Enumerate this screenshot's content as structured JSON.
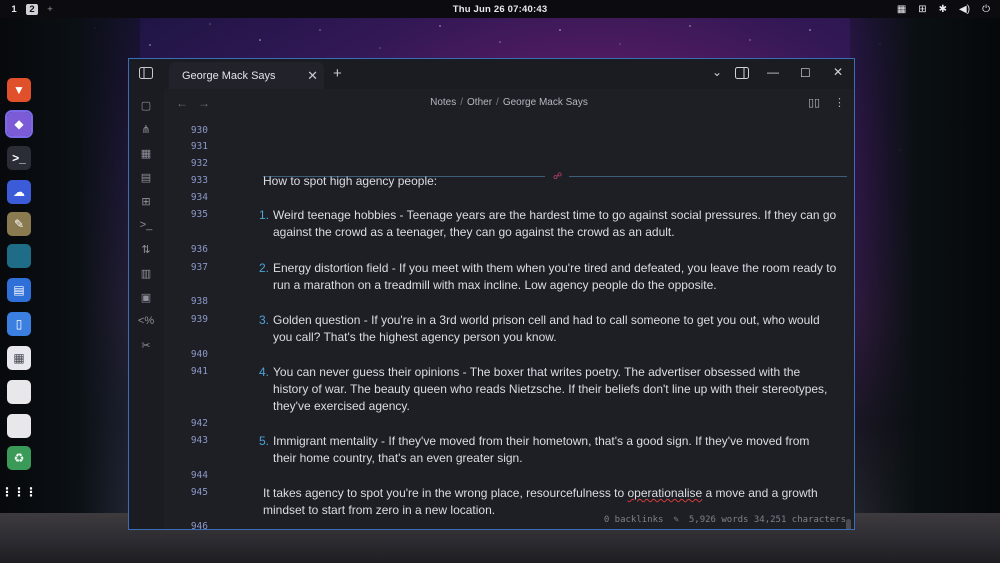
{
  "topbar": {
    "workspaces": [
      "1",
      "2"
    ],
    "active_workspace": "2",
    "add_workspace": "+",
    "clock": "Thu Jun 26  07:40:43"
  },
  "dock": {
    "apps": [
      {
        "name": "brave-icon",
        "color": "#e0502a",
        "glyph": "▼"
      },
      {
        "name": "obsidian-icon",
        "color": "#7b5cd6",
        "glyph": "◆"
      },
      {
        "name": "terminal-icon",
        "color": "#2a2d36",
        "glyph": ">_"
      },
      {
        "name": "weather-app-icon",
        "color": "#3b5bd9",
        "glyph": "☁"
      },
      {
        "name": "gimp-icon",
        "color": "#8a7a50",
        "glyph": "✎"
      },
      {
        "name": "panel-app-icon",
        "color": "#1f6c86",
        "glyph": ""
      },
      {
        "name": "document-editor-icon",
        "color": "#2f6fd8",
        "glyph": "▤"
      },
      {
        "name": "text-editor-icon",
        "color": "#3b7fe0",
        "glyph": "▯"
      },
      {
        "name": "software-store-icon",
        "color": "#e8e8ee",
        "glyph": "▦"
      },
      {
        "name": "blank-app-icon-1",
        "color": "#e8e8ea",
        "glyph": ""
      },
      {
        "name": "blank-app-icon-2",
        "color": "#e8e8ea",
        "glyph": ""
      },
      {
        "name": "trash-icon",
        "color": "#3a9a58",
        "glyph": "♻"
      },
      {
        "name": "app-grid-icon",
        "color": "transparent",
        "glyph": "⋮⋮⋮"
      }
    ]
  },
  "window": {
    "tab_title": "George Mack Says",
    "breadcrumb": [
      "Notes",
      "Other",
      "George Mack Says"
    ]
  },
  "editor": {
    "line_numbers": [
      "930",
      "931",
      "932",
      "933",
      "934",
      "935",
      "936",
      "937",
      "938",
      "939",
      "940",
      "941",
      "942",
      "943",
      "944",
      "945",
      "946"
    ],
    "heading": "How to spot high agency people:",
    "list": [
      {
        "n": "1.",
        "lines": [
          "Weird teenage hobbies - Teenage years are the hardest time to go against social pressures. If they can go",
          "against the crowd as a teenager, they can go against the crowd as an adult."
        ]
      },
      {
        "n": "2.",
        "lines": [
          "Energy distortion field - If you meet with them when you're tired and defeated, you leave the room ready to",
          "run a marathon on a treadmill with max incline. Low agency people do the opposite."
        ]
      },
      {
        "n": "3.",
        "lines": [
          "Golden question - If you're in a 3rd world prison cell and had to call someone to get you out, who would",
          "you call? That's the highest agency person you know."
        ]
      },
      {
        "n": "4.",
        "lines": [
          "You can never guess their opinions - The boxer that writes poetry. The advertiser obsessed with the",
          "history of war. The beauty queen who reads Nietzsche. If their beliefs don't line up with their stereotypes,",
          "they've exercised agency."
        ]
      },
      {
        "n": "5.",
        "lines": [
          "Immigrant mentality - If they've moved from their hometown, that's a good sign. If they've moved from",
          "their home country, that's an even greater sign."
        ]
      }
    ],
    "closing_a": "It takes agency to spot you're in the wrong place, resourcefulness to ",
    "closing_misspelled": "operationalise",
    "closing_b": " a move and a growth",
    "closing_line2": "mindset to start from zero in a new location."
  },
  "status": {
    "backlinks": "0 backlinks",
    "counts": "5,926 words 34,251 characters"
  }
}
